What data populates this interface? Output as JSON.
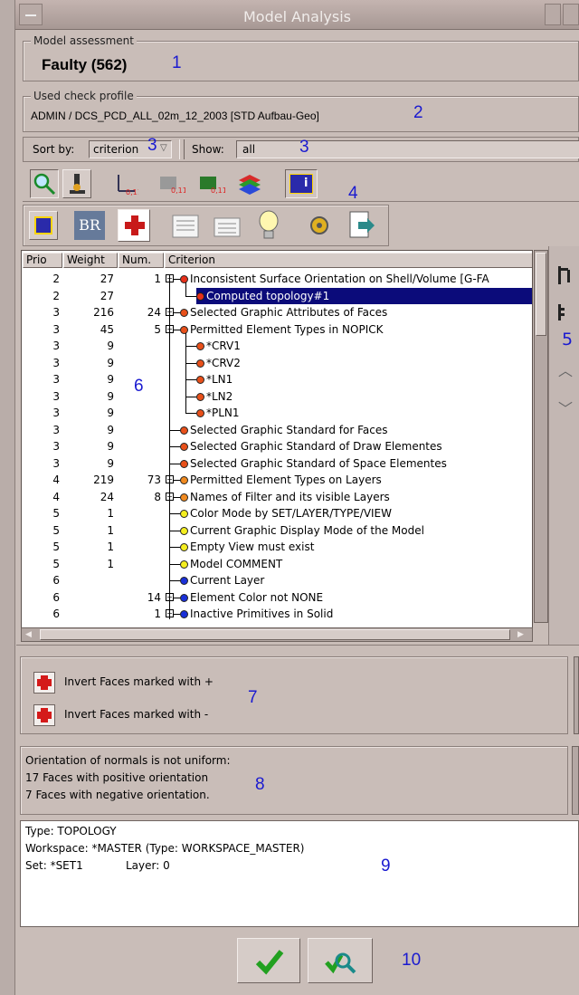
{
  "window": {
    "title": "Model Analysis"
  },
  "assessment": {
    "legend": "Model assessment",
    "value": "Faulty (562)"
  },
  "profile": {
    "legend": "Used check profile",
    "value": "ADMIN / DCS_PCD_ALL_02m_12_2003 [STD Aufbau-Geo]"
  },
  "filters": {
    "sort_label": "Sort by:",
    "sort_value": "criterion",
    "show_label": "Show:",
    "show_value": "all"
  },
  "table": {
    "headers": [
      "Prio",
      "Weight",
      "Num.",
      "Criterion"
    ],
    "rows": [
      {
        "prio": "2",
        "weight": "27",
        "num": "1",
        "criterion": "Inconsistent Surface Orientation on Shell/Volume [G-FA",
        "color": "#e8301a",
        "level": 0,
        "expander": "-"
      },
      {
        "prio": "2",
        "weight": "27",
        "num": "",
        "criterion": "Computed topology#1",
        "color": "#e8301a",
        "level": 1,
        "selected": true
      },
      {
        "prio": "3",
        "weight": "216",
        "num": "24",
        "criterion": "Selected Graphic Attributes of Faces",
        "color": "#e8501a",
        "level": 0,
        "expander": "+"
      },
      {
        "prio": "3",
        "weight": "45",
        "num": "5",
        "criterion": "Permitted Element Types in NOPICK",
        "color": "#e8501a",
        "level": 0,
        "expander": "-"
      },
      {
        "prio": "3",
        "weight": "9",
        "num": "",
        "criterion": "*CRV1",
        "color": "#e8501a",
        "level": 1
      },
      {
        "prio": "3",
        "weight": "9",
        "num": "",
        "criterion": "*CRV2",
        "color": "#e8501a",
        "level": 1
      },
      {
        "prio": "3",
        "weight": "9",
        "num": "",
        "criterion": "*LN1",
        "color": "#e8501a",
        "level": 1
      },
      {
        "prio": "3",
        "weight": "9",
        "num": "",
        "criterion": "*LN2",
        "color": "#e8501a",
        "level": 1
      },
      {
        "prio": "3",
        "weight": "9",
        "num": "",
        "criterion": "*PLN1",
        "color": "#e8501a",
        "level": 1
      },
      {
        "prio": "3",
        "weight": "9",
        "num": "",
        "criterion": "Selected Graphic Standard for Faces",
        "color": "#e8501a",
        "level": 0
      },
      {
        "prio": "3",
        "weight": "9",
        "num": "",
        "criterion": "Selected Graphic Standard of Draw Elementes",
        "color": "#e8501a",
        "level": 0
      },
      {
        "prio": "3",
        "weight": "9",
        "num": "",
        "criterion": "Selected Graphic Standard of Space Elementes",
        "color": "#e8501a",
        "level": 0
      },
      {
        "prio": "4",
        "weight": "219",
        "num": "73",
        "criterion": "Permitted Element Types on Layers",
        "color": "#f08a20",
        "level": 0,
        "expander": "+"
      },
      {
        "prio": "4",
        "weight": "24",
        "num": "8",
        "criterion": "Names of Filter and its visible Layers",
        "color": "#f08a20",
        "level": 0,
        "expander": "+"
      },
      {
        "prio": "5",
        "weight": "1",
        "num": "",
        "criterion": "Color Mode by SET/LAYER/TYPE/VIEW",
        "color": "#f4ee20",
        "level": 0
      },
      {
        "prio": "5",
        "weight": "1",
        "num": "",
        "criterion": "Current Graphic Display Mode of the Model",
        "color": "#f4ee20",
        "level": 0
      },
      {
        "prio": "5",
        "weight": "1",
        "num": "",
        "criterion": "Empty View must exist",
        "color": "#f4ee20",
        "level": 0
      },
      {
        "prio": "5",
        "weight": "1",
        "num": "",
        "criterion": "Model COMMENT",
        "color": "#f4ee20",
        "level": 0
      },
      {
        "prio": "6",
        "weight": "",
        "num": "",
        "criterion": "Current Layer",
        "color": "#1a30d8",
        "level": 0
      },
      {
        "prio": "6",
        "weight": "",
        "num": "14",
        "criterion": "Element Color not  NONE",
        "color": "#1a30d8",
        "level": 0,
        "expander": "+"
      },
      {
        "prio": "6",
        "weight": "",
        "num": "1",
        "criterion": "Inactive Primitives in Solid",
        "color": "#1a30d8",
        "level": 0,
        "expander": "+"
      }
    ]
  },
  "actions": [
    {
      "label": "Invert Faces marked with +"
    },
    {
      "label": "Invert Faces marked with -"
    }
  ],
  "info": {
    "line1": "Orientation of normals is not uniform:",
    "line2": "17 Faces with positive orientation",
    "line3": "7 Faces with negative orientation."
  },
  "details": {
    "type": "Type: TOPOLOGY",
    "workspace": "Workspace: *MASTER (Type: WORKSPACE_MASTER)",
    "set": "Set: *SET1",
    "layer": "Layer: 0"
  },
  "markers": [
    "1",
    "2",
    "3",
    "3",
    "4",
    "5",
    "6",
    "7",
    "8",
    "9",
    "10"
  ],
  "toolbar": {
    "br_label": "BR",
    "info_label": "i"
  },
  "colors": {
    "background": "#c9bdb8",
    "selection": "#0b0b7a",
    "confirm_green": "#22a020"
  }
}
